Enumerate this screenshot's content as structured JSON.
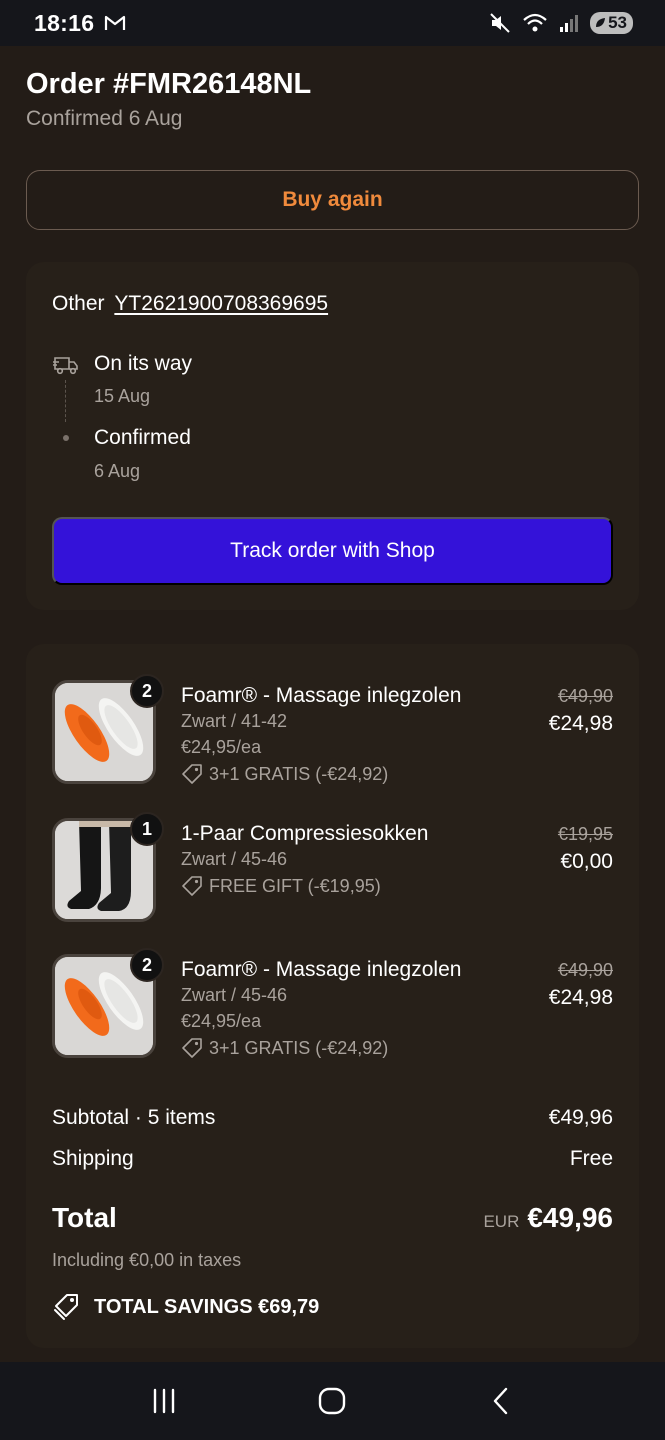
{
  "status_bar": {
    "time": "18:16",
    "battery": "53"
  },
  "order": {
    "title": "Order #FMR26148NL",
    "subtitle": "Confirmed 6 Aug"
  },
  "buy_again_label": "Buy again",
  "tracking": {
    "carrier_label": "Other",
    "tracking_number": "YT2621900708369695",
    "steps": [
      {
        "title": "On its way",
        "date": "15 Aug",
        "icon": "truck-icon"
      },
      {
        "title": "Confirmed",
        "date": "6 Aug",
        "icon": "dot-icon"
      }
    ],
    "track_button_label": "Track order with Shop"
  },
  "items": [
    {
      "quantity": "2",
      "name": "Foamr® - Massage inlegzolen",
      "variant": "Zwart / 41-42",
      "unit_price": "€24,95/ea",
      "discount": "3+1 GRATIS (-€24,92)",
      "old_price": "€49,90",
      "price": "€24,98",
      "image": "insoles"
    },
    {
      "quantity": "1",
      "name": "1-Paar Compressiesokken",
      "variant": "Zwart / 45-46",
      "unit_price": "",
      "discount": "FREE GIFT (-€19,95)",
      "old_price": "€19,95",
      "price": "€0,00",
      "image": "socks"
    },
    {
      "quantity": "2",
      "name": "Foamr® - Massage inlegzolen",
      "variant": "Zwart / 45-46",
      "unit_price": "€24,95/ea",
      "discount": "3+1 GRATIS (-€24,92)",
      "old_price": "€49,90",
      "price": "€24,98",
      "image": "insoles"
    }
  ],
  "summary": {
    "subtotal_label": "Subtotal · 5 items",
    "subtotal_value": "€49,96",
    "shipping_label": "Shipping",
    "shipping_value": "Free",
    "total_label": "Total",
    "currency": "EUR",
    "total_value": "€49,96",
    "taxes_note": "Including €0,00 in taxes",
    "savings": "TOTAL SAVINGS €69,79"
  },
  "colors": {
    "accent": "#f08a3c",
    "track_button": "#3412d9",
    "background": "#231c17",
    "card": "#272019"
  }
}
